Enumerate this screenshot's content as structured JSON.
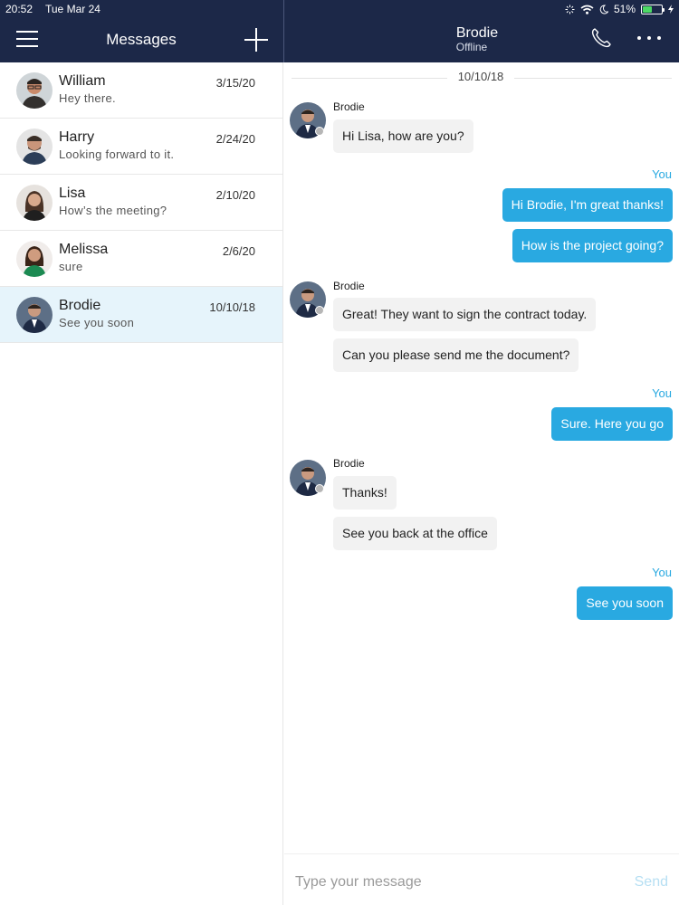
{
  "status_bar": {
    "time": "20:52",
    "date": "Tue Mar 24",
    "battery": "51%",
    "battery_level": 0.51
  },
  "left_header": {
    "title": "Messages",
    "menu_icon": "hamburger-icon",
    "compose_icon": "plus-icon"
  },
  "chat_header": {
    "name": "Brodie",
    "status": "Offline",
    "call_icon": "phone-icon",
    "more_icon": "ellipsis-icon"
  },
  "conversations": [
    {
      "name": "William",
      "preview": "Hey there.",
      "date": "3/15/20"
    },
    {
      "name": "Harry",
      "preview": "Looking forward to it.",
      "date": "2/24/20"
    },
    {
      "name": "Lisa",
      "preview": "How’s the meeting?",
      "date": "2/10/20"
    },
    {
      "name": "Melissa",
      "preview": "sure",
      "date": "2/6/20"
    },
    {
      "name": "Brodie",
      "preview": "See you soon",
      "date": "10/10/18"
    }
  ],
  "chat": {
    "date_separator": "10/10/18",
    "sender": "Brodie",
    "you_label": "You",
    "messages": [
      "Hi Lisa, how are you?",
      "Hi Brodie, I'm great thanks!",
      "How is the project going?",
      "Great! They want to sign the contract today.",
      "Can you please send me the document?",
      "Sure. Here you go",
      "Thanks!",
      "See you back at the office",
      "See you soon"
    ]
  },
  "composer": {
    "placeholder": "Type your message",
    "send_label": "Send"
  },
  "colors": {
    "header_bg": "#1c2848",
    "accent": "#29a9e1",
    "active_row": "#e6f4fb",
    "incoming_bubble": "#f2f2f2"
  }
}
